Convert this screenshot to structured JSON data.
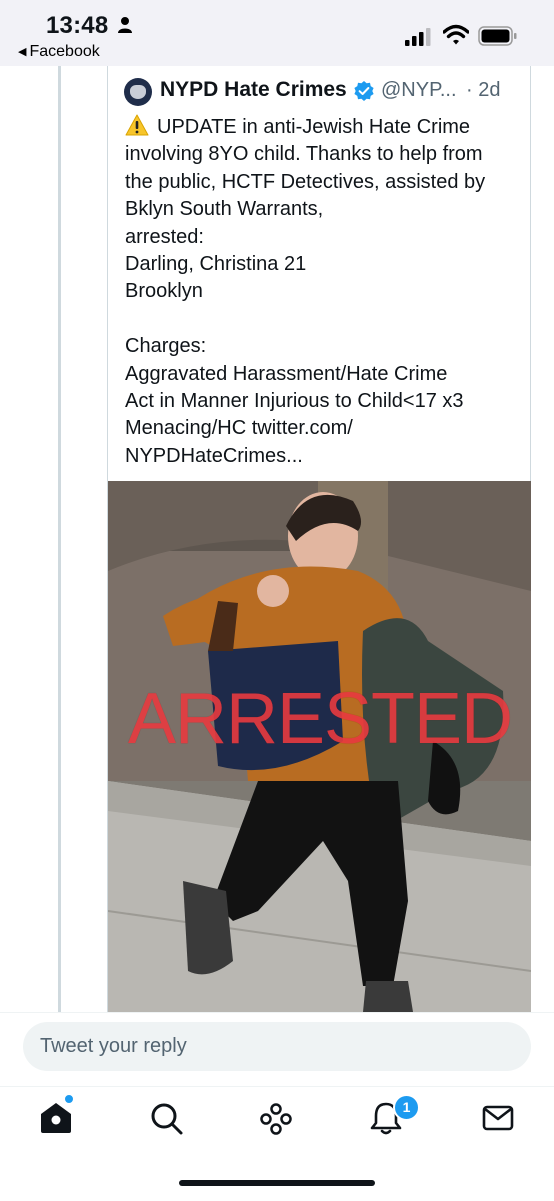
{
  "status_bar": {
    "time": "13:48",
    "back_app_label": "Facebook",
    "icons": [
      "person-icon",
      "signal-icon",
      "wifi-icon",
      "battery-icon"
    ]
  },
  "tweet": {
    "author_name": "NYPD Hate Crimes",
    "handle": "@NYP...",
    "time_ago": "· 2d",
    "warning_icon": "warning-icon",
    "lines": [
      "UPDATE in anti-Jewish Hate Crime",
      "involving 8YO child. Thanks to help from",
      "the public, HCTF Detectives, assisted by",
      "Bklyn South Warrants,",
      "arrested:",
      "Darling, Christina 21",
      "Brooklyn",
      "",
      "Charges:",
      "Aggravated Harassment/Hate Crime",
      "Act in Manner Injurious to Child<17 x3",
      "Menacing/HC twitter.com/",
      "NYPDHateCrimes..."
    ],
    "image_overlay_text": "ARRESTED"
  },
  "reply": {
    "placeholder": "Tweet your reply"
  },
  "tab_bar": {
    "tabs": [
      "home-icon",
      "search-icon",
      "spaces-icon",
      "notifications-icon",
      "messages-icon"
    ],
    "notification_count": "1"
  },
  "colors": {
    "accent": "#1d9bf0",
    "text": "#0f1419",
    "muted": "#536471",
    "overlay_red": "#e83a3f"
  }
}
